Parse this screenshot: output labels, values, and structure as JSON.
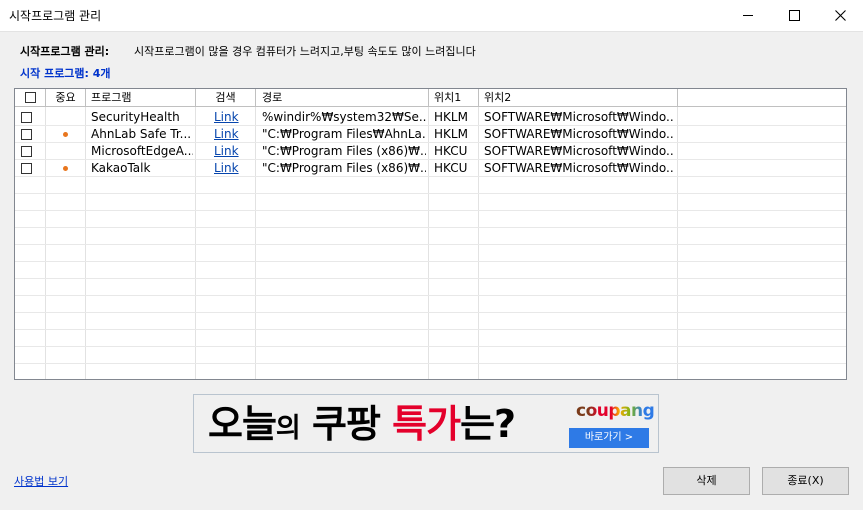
{
  "window": {
    "title": "시작프로그램 관리"
  },
  "header": {
    "label": "시작프로그램 관리:",
    "description": "시작프로그램이 많을 경우 컴퓨터가 느려지고,부팅 속도도 많이 느려집니다",
    "count": "시작 프로그램: 4개"
  },
  "table": {
    "columns": [
      "중요",
      "프로그램",
      "검색",
      "경로",
      "위치1",
      "위치2"
    ],
    "rows": [
      {
        "important": false,
        "program": "SecurityHealth",
        "search": "Link",
        "path": "%windir%₩system32₩Se...",
        "loc1": "HKLM",
        "loc2": "SOFTWARE₩Microsoft₩Windo..."
      },
      {
        "important": true,
        "program": "AhnLab Safe Tr...",
        "search": "Link",
        "path": "\"C:₩Program Files₩AhnLa...",
        "loc1": "HKLM",
        "loc2": "SOFTWARE₩Microsoft₩Windo..."
      },
      {
        "important": false,
        "program": "MicrosoftEdgeA...",
        "search": "Link",
        "path": "\"C:₩Program Files (x86)₩...",
        "loc1": "HKCU",
        "loc2": "SOFTWARE₩Microsoft₩Windo..."
      },
      {
        "important": true,
        "program": "KakaoTalk",
        "search": "Link",
        "path": "\"C:₩Program Files (x86)₩...",
        "loc1": "HKCU",
        "loc2": "SOFTWARE₩Microsoft₩Windo..."
      }
    ]
  },
  "banner": {
    "text_a": "오늘",
    "text_b": "의",
    "text_c": " 쿠팡 ",
    "text_d": "특가",
    "text_e": "는?",
    "brand": "coupang",
    "button": "바로가기 >"
  },
  "footer": {
    "usage_link": "사용법 보기",
    "delete_button": "삭제",
    "close_button": "종료(X)"
  },
  "colors": {
    "accent": "#0033cc",
    "dot": "#e8761e",
    "link": "#0645ad",
    "ad_red": "#e4002b",
    "ad_blue": "#2e7ae6"
  }
}
